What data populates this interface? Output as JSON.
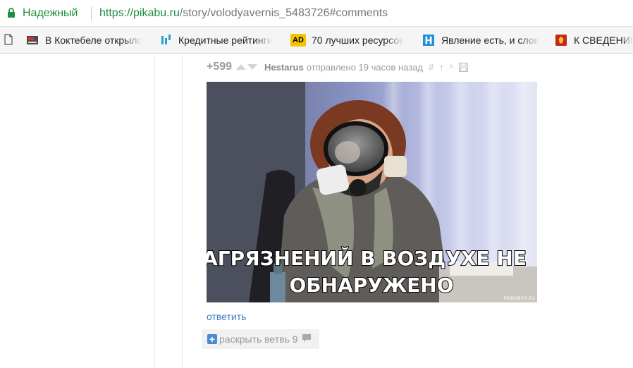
{
  "browser": {
    "secure_label": "Надежный",
    "url_protocol": "https://",
    "url_host": "pikabu.ru",
    "url_path": "/story/volodyavernis_5483726#comments"
  },
  "bookmarks": [
    {
      "label": "В Коктебеле открыло",
      "icon": "news-favicon"
    },
    {
      "label": "Кредитные рейтинги",
      "icon": "chart-favicon"
    },
    {
      "label": "70 лучших ресурсов",
      "icon": "ad-favicon",
      "badge": "AD"
    },
    {
      "label": "Явление есть, и слов",
      "icon": "h-favicon"
    },
    {
      "label": "К СВЕДЕНИЮ",
      "icon": "emblem-favicon"
    }
  ],
  "comment": {
    "rating": "+599",
    "author": "Hestarus",
    "sent_text": "отправлено 19 часов назад",
    "actions": [
      "#",
      "↑",
      "ʰ",
      "save"
    ],
    "image": {
      "caption_line1": "ЗАГРЯЗНЕНИЙ В ВОЗДУХЕ НЕ",
      "caption_line2": "ОБНАРУЖЕНО",
      "watermark": "risovach.ru"
    },
    "reply_label": "ответить",
    "expand_label": "раскрыть ветвь 9"
  },
  "colors": {
    "secure_green": "#1e8e3e",
    "link_blue": "#3d7ac5",
    "expand_icon_blue": "#4a8bd0"
  }
}
